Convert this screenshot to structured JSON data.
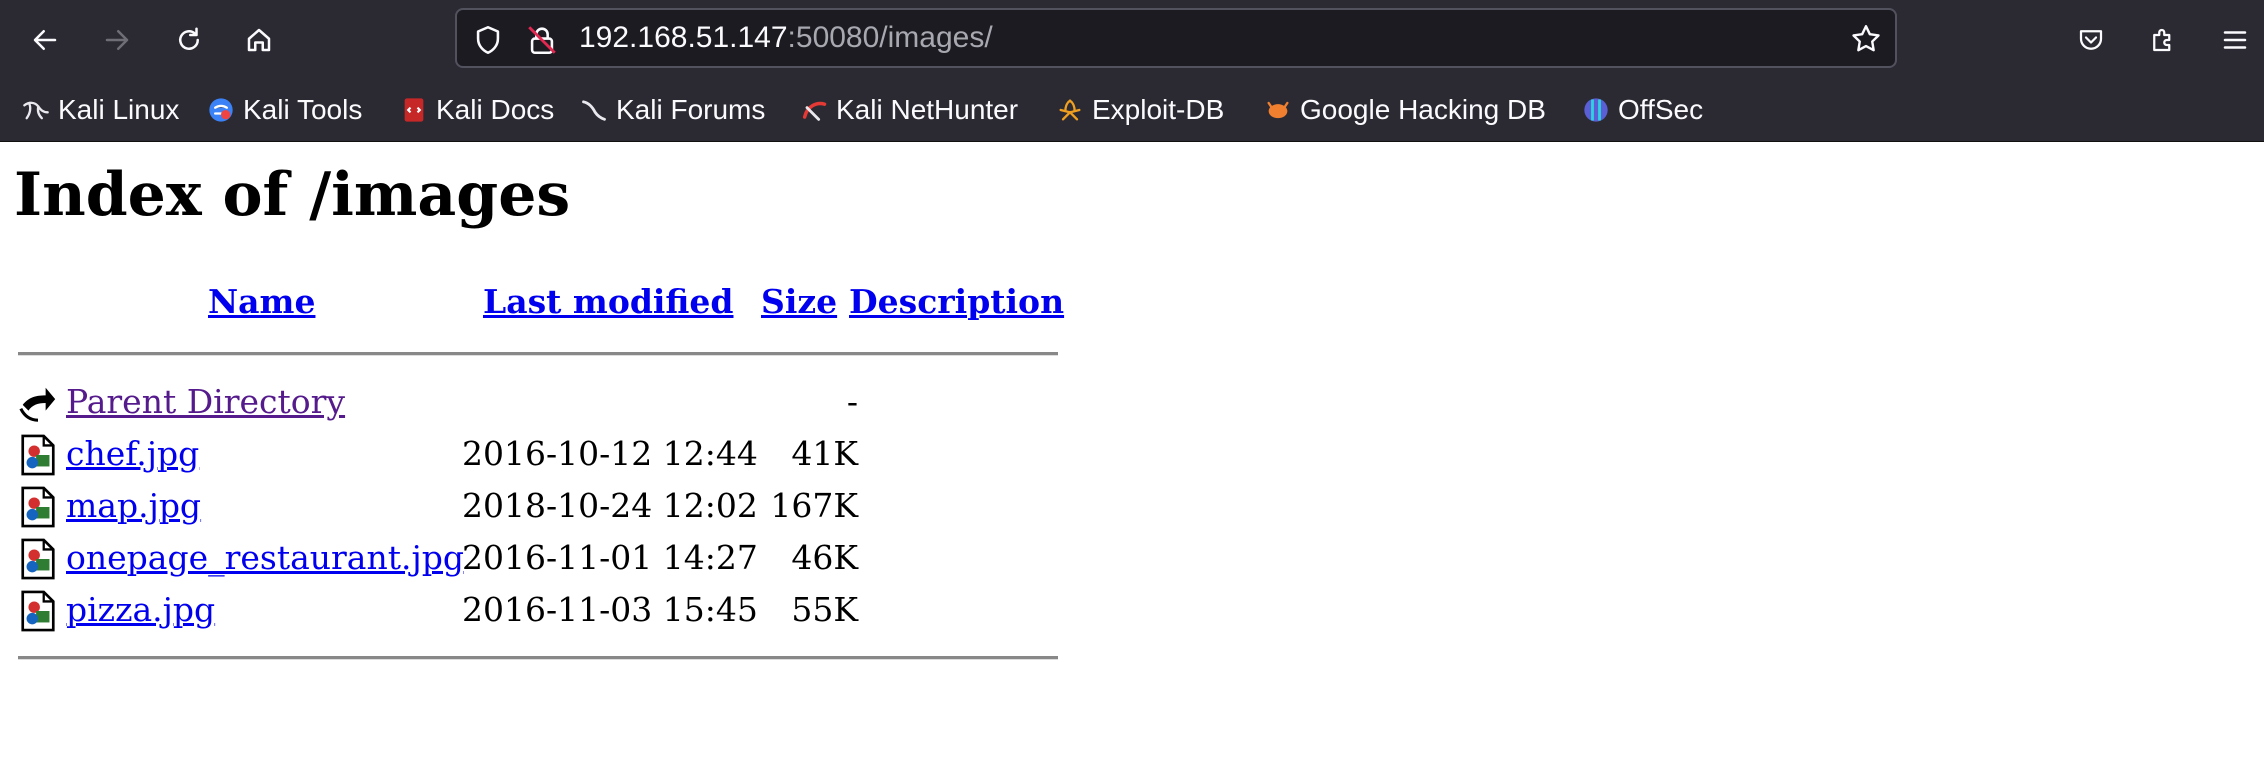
{
  "browser": {
    "url_host": "192.168.51.147",
    "url_rest": ":50080/images/",
    "bookmarks": [
      {
        "label": "Kali Linux",
        "icon": "kali-dragon-icon"
      },
      {
        "label": "Kali Tools",
        "icon": "kali-tools-icon"
      },
      {
        "label": "Kali Docs",
        "icon": "kali-docs-icon"
      },
      {
        "label": "Kali Forums",
        "icon": "kali-forums-icon"
      },
      {
        "label": "Kali NetHunter",
        "icon": "nethunter-icon"
      },
      {
        "label": "Exploit-DB",
        "icon": "exploit-db-icon"
      },
      {
        "label": "Google Hacking DB",
        "icon": "ghdb-icon"
      },
      {
        "label": "OffSec",
        "icon": "offsec-icon"
      }
    ]
  },
  "page": {
    "title": "Index of /images",
    "columns": {
      "name": "Name",
      "last_modified": "Last modified",
      "size": "Size",
      "description": "Description"
    },
    "parent": {
      "label": "Parent Directory",
      "size": "-"
    },
    "files": [
      {
        "name": "chef.jpg",
        "modified": "2016-10-12 12:44",
        "size": "41K"
      },
      {
        "name": "map.jpg",
        "modified": "2018-10-24 12:02",
        "size": "167K"
      },
      {
        "name": "onepage_restaurant.jpg",
        "modified": "2016-11-01 14:27",
        "size": "46K"
      },
      {
        "name": "pizza.jpg",
        "modified": "2016-11-03 15:45",
        "size": "55K"
      }
    ]
  }
}
